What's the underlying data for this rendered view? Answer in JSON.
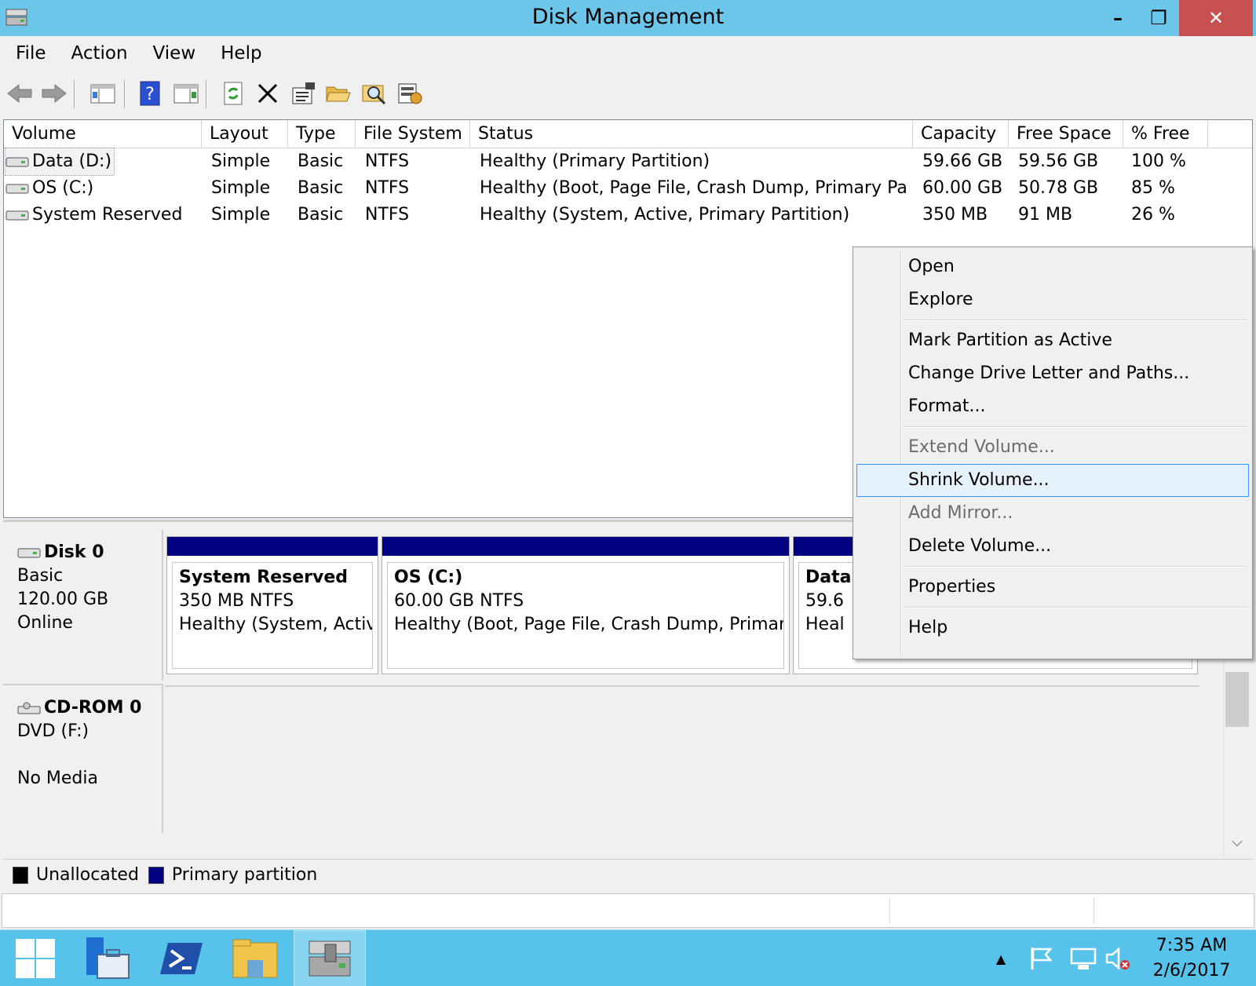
{
  "window": {
    "title": "Disk Management",
    "controls": {
      "minimize": "–",
      "maximize": "❐",
      "close": "✕"
    }
  },
  "menu": [
    "File",
    "Action",
    "View",
    "Help"
  ],
  "toolbar": {
    "icons": [
      "back-arrow-icon",
      "forward-arrow-icon",
      "console-tree-icon",
      "help-icon",
      "action-pane-icon",
      "refresh-icon",
      "delete-icon",
      "properties-icon",
      "open-folder-icon",
      "search-disk-icon",
      "settings-icon"
    ]
  },
  "volume_table": {
    "columns": [
      "Volume",
      "Layout",
      "Type",
      "File System",
      "Status",
      "Capacity",
      "Free Space",
      "% Free"
    ],
    "rows": [
      {
        "volume": "Data (D:)",
        "layout": "Simple",
        "type": "Basic",
        "fs": "NTFS",
        "status": "Healthy (Primary Partition)",
        "capacity": "59.66 GB",
        "free": "59.56 GB",
        "pct": "100 %"
      },
      {
        "volume": "OS (C:)",
        "layout": "Simple",
        "type": "Basic",
        "fs": "NTFS",
        "status": "Healthy (Boot, Page File, Crash Dump, Primary Par...",
        "capacity": "60.00 GB",
        "free": "50.78 GB",
        "pct": "85 %"
      },
      {
        "volume": "System Reserved",
        "layout": "Simple",
        "type": "Basic",
        "fs": "NTFS",
        "status": "Healthy (System, Active, Primary Partition)",
        "capacity": "350 MB",
        "free": "91 MB",
        "pct": "26 %"
      }
    ]
  },
  "disks": {
    "disk0": {
      "name": "Disk 0",
      "type": "Basic",
      "size": "120.00 GB",
      "state": "Online",
      "partitions": [
        {
          "name": "System Reserved",
          "size": "350 MB NTFS",
          "status": "Healthy (System, Active"
        },
        {
          "name": "OS  (C:)",
          "size": "60.00 GB NTFS",
          "status": "Healthy (Boot, Page File, Crash Dump, Primary"
        },
        {
          "name": "Data",
          "size": "59.6",
          "status": "Heal"
        }
      ]
    },
    "cdrom0": {
      "name": "CD-ROM 0",
      "drive": "DVD (F:)",
      "state": "No Media"
    }
  },
  "legend": {
    "unallocated": {
      "label": "Unallocated",
      "color": "#000000"
    },
    "primary": {
      "label": "Primary partition",
      "color": "#000080"
    }
  },
  "context_menu": {
    "items": [
      {
        "label": "Open",
        "disabled": false
      },
      {
        "label": "Explore",
        "disabled": false
      },
      {
        "label": "Mark Partition as Active",
        "disabled": false
      },
      {
        "label": "Change Drive Letter and Paths...",
        "disabled": false
      },
      {
        "label": "Format...",
        "disabled": false
      },
      {
        "label": "Extend Volume...",
        "disabled": true
      },
      {
        "label": "Shrink Volume...",
        "disabled": false,
        "highlighted": true
      },
      {
        "label": "Add Mirror...",
        "disabled": true
      },
      {
        "label": "Delete Volume...",
        "disabled": false
      },
      {
        "label": "Properties",
        "disabled": false
      },
      {
        "label": "Help",
        "disabled": false
      }
    ]
  },
  "taskbar": {
    "apps": [
      "windows-start-icon",
      "server-manager-icon",
      "powershell-icon",
      "file-explorer-icon",
      "disk-management-icon"
    ],
    "tray": [
      "show-hidden-icons-icon",
      "action-center-flag-icon",
      "network-icon",
      "volume-muted-icon"
    ],
    "time": "7:35 AM",
    "date": "2/6/2017"
  },
  "colors": {
    "titlebar": "#6cc6ea",
    "taskbar": "#57c3ea",
    "close_button": "#c75050",
    "primary_partition": "#000080",
    "menu_highlight": "#e5f1fb"
  }
}
